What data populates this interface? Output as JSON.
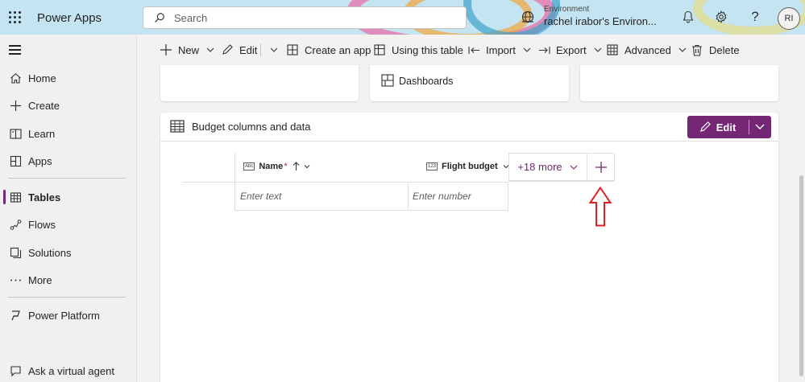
{
  "header": {
    "brand": "Power Apps",
    "search_placeholder": "Search",
    "environment_label": "Environment",
    "environment_name": "rachel irabor's Environ...",
    "avatar_initials": "RI"
  },
  "nav": {
    "items": [
      {
        "label": "Home",
        "icon": "home-icon"
      },
      {
        "label": "Create",
        "icon": "plus-icon"
      },
      {
        "label": "Learn",
        "icon": "book-icon"
      },
      {
        "label": "Apps",
        "icon": "apps-icon"
      },
      {
        "label": "Tables",
        "icon": "table-icon",
        "active": true
      },
      {
        "label": "Flows",
        "icon": "flow-icon"
      },
      {
        "label": "Solutions",
        "icon": "solutions-icon"
      },
      {
        "label": "More",
        "icon": "ellipsis-icon"
      },
      {
        "label": "Power Platform",
        "icon": "power-platform-icon"
      },
      {
        "label": "Ask a virtual agent",
        "icon": "virtual-agent-icon"
      }
    ]
  },
  "commands": {
    "new": "New",
    "edit": "Edit",
    "create_app": "Create an app",
    "using_table": "Using this table",
    "import": "Import",
    "export": "Export",
    "advanced": "Advanced",
    "delete": "Delete"
  },
  "cards": {
    "dashboards": "Dashboards"
  },
  "panel": {
    "title": "Budget columns and data",
    "edit_label": "Edit",
    "columns": [
      {
        "label": "Name",
        "required_mark": "*",
        "type_badge": "Abc",
        "placeholder": "Enter text"
      },
      {
        "label": "Flight budget",
        "type_badge": "123",
        "placeholder": "Enter number"
      }
    ],
    "more_columns": "+18 more"
  },
  "colors": {
    "accent": "#742774",
    "annotation_arrow": "#e02020"
  }
}
